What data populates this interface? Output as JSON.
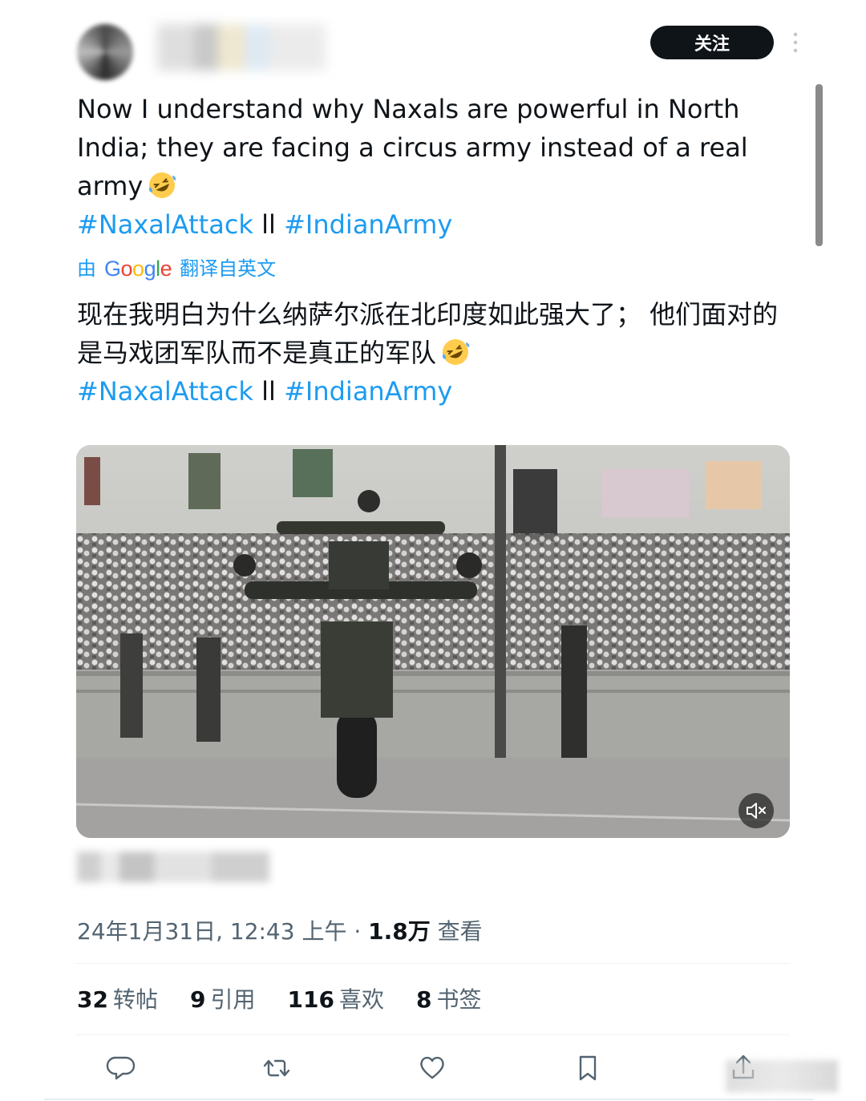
{
  "header": {
    "follow_label": "关注"
  },
  "tweet": {
    "text_main": "Now I understand why Naxals are powerful in North India; they are facing a circus army instead of a real army",
    "hashtag_1": "#NaxalAttack",
    "separator": " ll ",
    "hashtag_2": "#IndianArmy",
    "emoji_icon": "rolling-on-the-floor-laughing-emoji"
  },
  "translation": {
    "prefix": "由",
    "provider": "Google",
    "suffix": "翻译自英文",
    "text_main": "现在我明白为什么纳萨尔派在北印度如此强大了； 他们面对的是马戏团军队而不是真正的军队",
    "hashtag_1": "#NaxalAttack",
    "separator": " ll ",
    "hashtag_2": "#IndianArmy"
  },
  "media": {
    "type": "video",
    "mute_icon": "volume-muted-icon"
  },
  "meta": {
    "timestamp": "24年1月31日, 12:43 上午",
    "dot": " · ",
    "views_count": "1.8万",
    "views_label": " 查看"
  },
  "stats": [
    {
      "count": "32",
      "label": "转帖"
    },
    {
      "count": "9",
      "label": "引用"
    },
    {
      "count": "116",
      "label": "喜欢"
    },
    {
      "count": "8",
      "label": "书签"
    }
  ],
  "actions": {
    "reply_icon": "reply-icon",
    "retweet_icon": "retweet-icon",
    "like_icon": "heart-icon",
    "bookmark_icon": "bookmark-icon",
    "share_icon": "share-icon"
  },
  "colors": {
    "link": "#1d9bf0",
    "text": "#0f1419",
    "muted": "#536471",
    "button_bg": "#0f1419"
  }
}
